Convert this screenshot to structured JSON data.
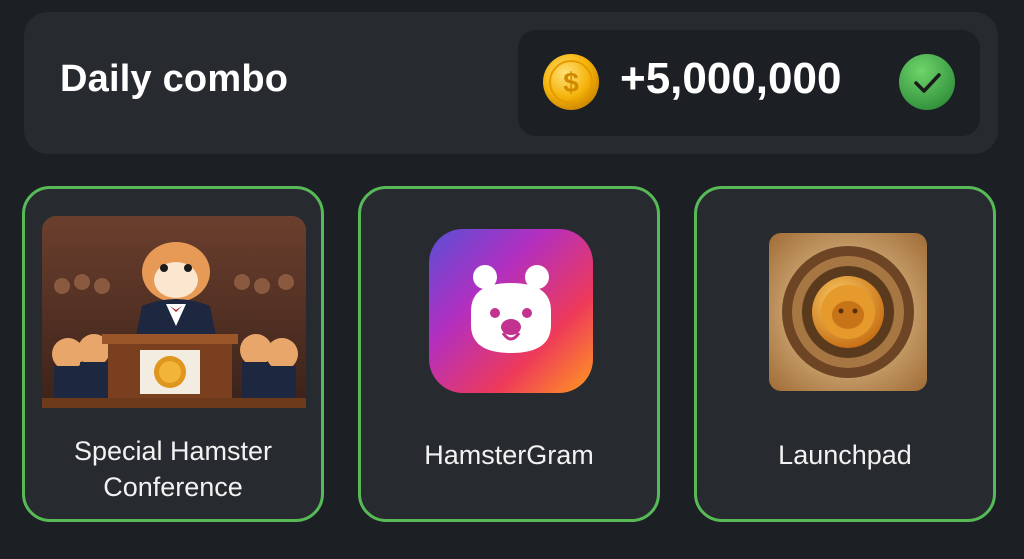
{
  "header": {
    "title": "Daily combo",
    "reward": "+5,000,000",
    "coin_icon": "dollar-coin-icon",
    "check_icon": "green-check-icon"
  },
  "cards": [
    {
      "label": "Special Hamster Conference",
      "image": "hamster-conference-image"
    },
    {
      "label": "HamsterGram",
      "image": "hamstergram-app-icon"
    },
    {
      "label": "Launchpad",
      "image": "launchpad-coin-image"
    }
  ],
  "colors": {
    "background": "#1c1f24",
    "panel": "#272a2f",
    "card_border": "#58b957",
    "check_green": "#3fa84b",
    "coin_gold": "#f5b30a"
  }
}
